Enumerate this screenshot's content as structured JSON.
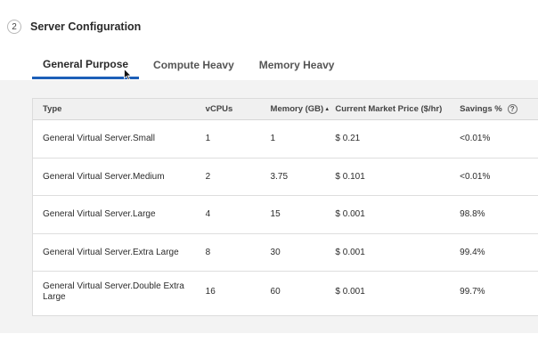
{
  "section": {
    "step_number": "2",
    "title": "Server Configuration"
  },
  "tabs": [
    {
      "label": "General Purpose",
      "active": true
    },
    {
      "label": "Compute Heavy",
      "active": false
    },
    {
      "label": "Memory Heavy",
      "active": false
    }
  ],
  "table": {
    "columns": {
      "type": "Type",
      "vcpus": "vCPUs",
      "memory": "Memory (GB)",
      "price": "Current Market Price ($/hr)",
      "savings": "Savings %"
    },
    "rows": [
      {
        "type": "General Virtual Server.Small",
        "vcpus": "1",
        "memory": "1",
        "price": "$ 0.21",
        "savings": "<0.01%"
      },
      {
        "type": "General Virtual Server.Medium",
        "vcpus": "2",
        "memory": "3.75",
        "price": "$ 0.101",
        "savings": "<0.01%"
      },
      {
        "type": "General Virtual Server.Large",
        "vcpus": "4",
        "memory": "15",
        "price": "$ 0.001",
        "savings": "98.8%"
      },
      {
        "type": "General Virtual Server.Extra Large",
        "vcpus": "8",
        "memory": "30",
        "price": "$ 0.001",
        "savings": "99.4%"
      },
      {
        "type": "General Virtual Server.Double Extra Large",
        "vcpus": "16",
        "memory": "60",
        "price": "$ 0.001",
        "savings": "99.7%"
      }
    ]
  },
  "icons": {
    "help": "question-circle-icon",
    "sort": "sort-descending-icon",
    "cursor": "mouse-pointer-icon"
  },
  "colors": {
    "active_tab_underline": "#1d5fb8",
    "panel_background": "#f3f3f3",
    "header_background": "#f0f0f0"
  }
}
